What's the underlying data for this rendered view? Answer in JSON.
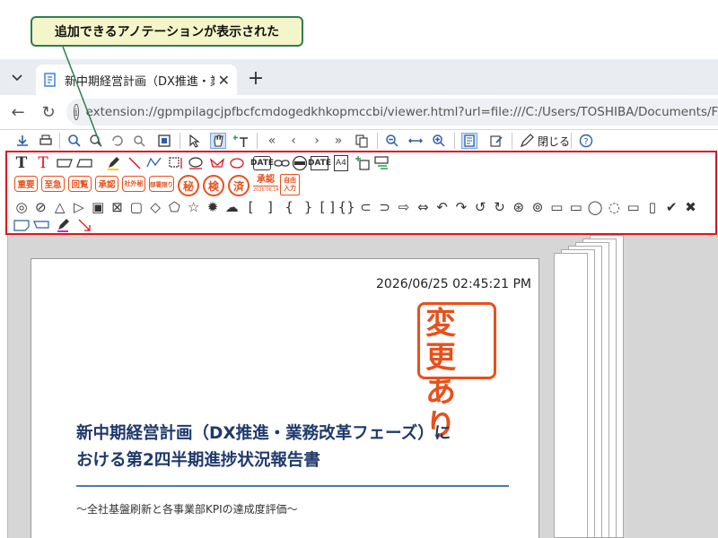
{
  "callout": {
    "text": "追加できるアノテーションが表示された"
  },
  "browser": {
    "tab_title": "新中期経営計画（DX推進・業務改革",
    "tab_close_glyph": "✕",
    "new_tab_glyph": "+",
    "back_glyph": "←",
    "reload_glyph": "↻",
    "info_glyph": "i",
    "url": "extension://gpmpilagcjpfbcfcmdogedkhkopmccbi/viewer.html?url=file:///C:/Users/TOSHIBA/Documents/FUJIFILM/Docu"
  },
  "toolbar": {
    "close_label": "閉じる",
    "icons": [
      "download-icon",
      "print-icon",
      "search-icon",
      "find-icon",
      "rotate-icon",
      "image-icon",
      "select-icon",
      "hand-icon",
      "text-insert-icon",
      "first-page-icon",
      "prev-page-icon",
      "next-page-icon",
      "last-page-icon",
      "page-icon",
      "zoom-out-icon",
      "fit-width-icon",
      "zoom-in-icon",
      "annotation-toggle-icon",
      "edit-icon",
      "pen-icon",
      "help-icon"
    ]
  },
  "annotations": {
    "row1_glyphs": [
      "T",
      "T",
      "▭",
      "▭",
      "✎",
      "╲",
      "⌒",
      "⊡",
      "⊙",
      "✉",
      "⬭",
      "▣",
      "⊂⊃",
      "⊜",
      "▦",
      "▥",
      "⊕",
      "⊞"
    ],
    "date_labels": [
      "DATE",
      "DATE"
    ],
    "a4_label": "A4",
    "stamps": [
      "重要",
      "至急",
      "回覧",
      "承認",
      "社外秘",
      "部署限り"
    ],
    "circle_stamps": [
      "秘",
      "検",
      "済"
    ],
    "approval_stamp": "承認",
    "approval_date": "2026.06.14",
    "free_stamp": "自由\n入力",
    "row3_glyphs": [
      "◎",
      "⊘",
      "△",
      "▷",
      "▣",
      "⊠",
      "▢",
      "◇",
      "⬠",
      "☆",
      "✹",
      "☁",
      "[",
      "]",
      "{",
      "}",
      "[ ]",
      "{}",
      "⊂",
      "⊃",
      "⇨",
      "⇔",
      "↶",
      "↷",
      "↺",
      "↻",
      "⊛",
      "⊚",
      "▭",
      "▭",
      "◯",
      "◌",
      "▭",
      "▯",
      "✔",
      "✖"
    ],
    "row4_glyphs": [
      "▭",
      "▭",
      "✎",
      "↘"
    ]
  },
  "document": {
    "timestamp": "2026/06/25 02:45:21 PM",
    "stamp_text": "変更あり",
    "title_line1": "新中期経営計画（DX推進・業務改革フェーズ）に",
    "title_line2": "おける第2四半期進捗状況報告書",
    "subtitle": "～全社基盤刷新と各事業部KPIの達成度評価～"
  },
  "colors": {
    "accent_red": "#e0141c",
    "stamp_orange": "#e8501c",
    "title_blue": "#1f3a6b",
    "callout_bg": "#f4f6c9",
    "callout_border": "#2e7d4f"
  }
}
